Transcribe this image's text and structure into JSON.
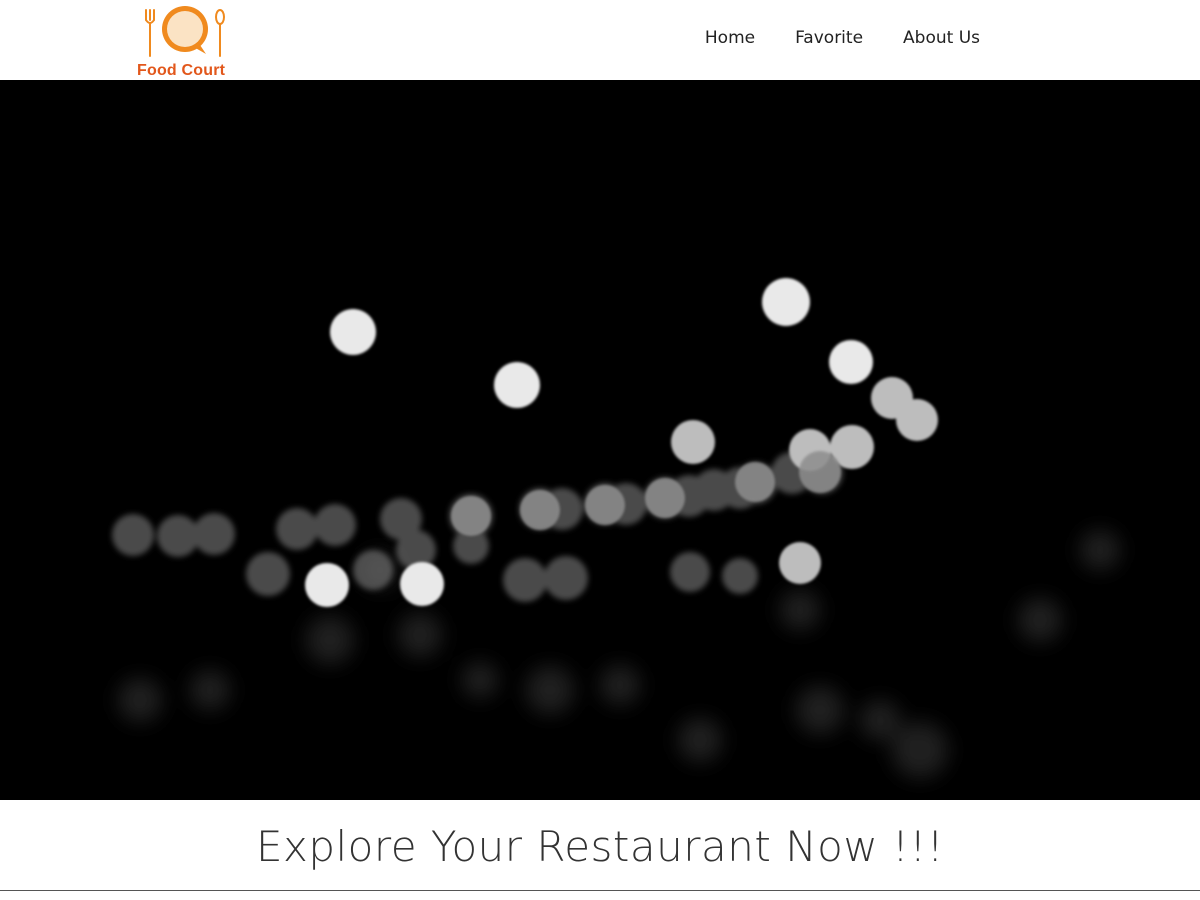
{
  "brand": {
    "name": "Food Court",
    "logo_icon": "plate-fork-spoon-icon",
    "accent_color": "#d8232a",
    "logo_color": "#f08a1e"
  },
  "nav": {
    "items": [
      {
        "label": "Home"
      },
      {
        "label": "Favorite"
      },
      {
        "label": "About Us"
      }
    ]
  },
  "hero": {
    "image": "night-bokeh-lights-background"
  },
  "tagline": {
    "text": "Explore Your Restaurant Now !!!"
  }
}
